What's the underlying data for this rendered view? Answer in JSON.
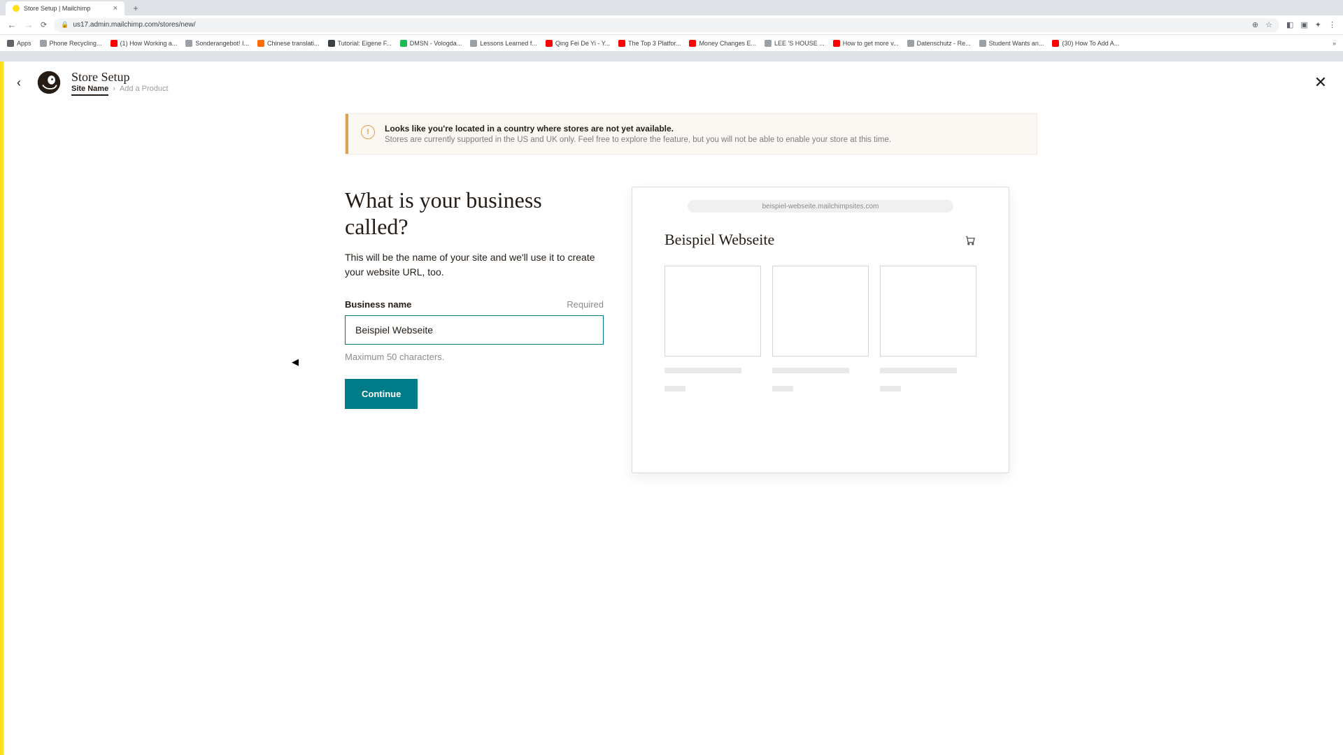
{
  "browser": {
    "tab_title": "Store Setup | Mailchimp",
    "url": "us17.admin.mailchimp.com/stores/new/",
    "apps_label": "Apps"
  },
  "bookmarks": [
    {
      "label": "Phone Recycling...",
      "color": "bm-gray"
    },
    {
      "label": "(1) How Working a...",
      "color": "bm-red"
    },
    {
      "label": "Sonderangebot! I...",
      "color": "bm-gray"
    },
    {
      "label": "Chinese translati...",
      "color": "bm-orange"
    },
    {
      "label": "Tutorial: Eigene F...",
      "color": "bm-dark"
    },
    {
      "label": "DMSN - Vologda...",
      "color": "bm-green"
    },
    {
      "label": "Lessons Learned f...",
      "color": "bm-gray"
    },
    {
      "label": "Qing Fei De Yi - Y...",
      "color": "bm-red"
    },
    {
      "label": "The Top 3 Platfor...",
      "color": "bm-red"
    },
    {
      "label": "Money Changes E...",
      "color": "bm-red"
    },
    {
      "label": "LEE 'S HOUSE ...",
      "color": "bm-gray"
    },
    {
      "label": "How to get more v...",
      "color": "bm-red"
    },
    {
      "label": "Datenschutz - Re...",
      "color": "bm-gray"
    },
    {
      "label": "Student Wants an...",
      "color": "bm-gray"
    },
    {
      "label": "(30) How To Add A...",
      "color": "bm-red"
    }
  ],
  "header": {
    "app_title": "Store Setup",
    "breadcrumb_current": "Site Name",
    "breadcrumb_next": "Add a Product"
  },
  "banner": {
    "title": "Looks like you're located in a country where stores are not yet available.",
    "body": "Stores are currently supported in the US and UK only. Feel free to explore the feature, but you will not be able to enable your store at this time."
  },
  "form": {
    "heading": "What is your business called?",
    "description": "This will be the name of your site and we'll use it to create your website URL, too.",
    "label": "Business name",
    "required": "Required",
    "value": "Beispiel Webseite",
    "hint": "Maximum 50 characters.",
    "continue": "Continue"
  },
  "preview": {
    "url": "beispiel-webseite.mailchimpsites.com",
    "site_title": "Beispiel Webseite"
  }
}
